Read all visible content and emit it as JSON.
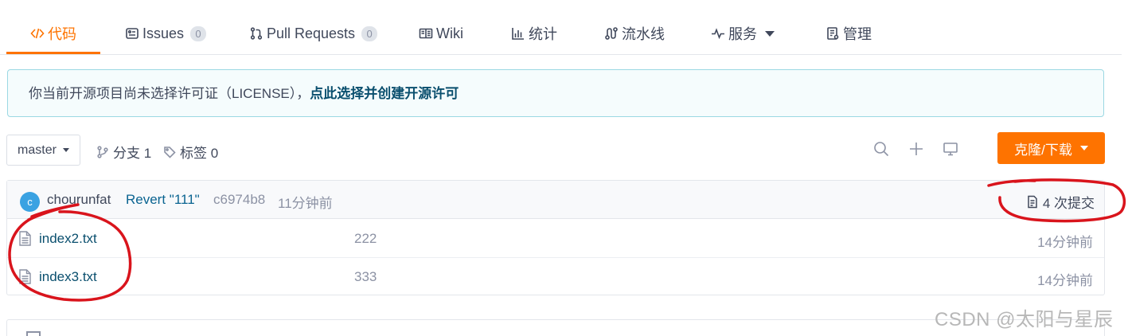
{
  "tabs": [
    {
      "label": "代码",
      "icon": "code-icon",
      "active": true
    },
    {
      "label": "Issues",
      "icon": "issues-icon",
      "count": "0"
    },
    {
      "label": "Pull Requests",
      "icon": "pull-request-icon",
      "count": "0"
    },
    {
      "label": "Wiki",
      "icon": "book-icon"
    },
    {
      "label": "统计",
      "icon": "bar-chart-icon"
    },
    {
      "label": "流水线",
      "icon": "pipeline-icon"
    },
    {
      "label": "服务",
      "icon": "pulse-icon"
    },
    {
      "label": "管理",
      "icon": "settings-doc-icon"
    }
  ],
  "notice": {
    "text": "你当前开源项目尚未选择许可证（LICENSE），",
    "link": "点此选择并创建开源许可"
  },
  "repo": {
    "branch": "master",
    "branches": "分支 1",
    "tags": "标签 0",
    "clone_label": "克隆/下载"
  },
  "commit": {
    "avatar_letter": "c",
    "author": "chourunfat",
    "message": "Revert \"111\"",
    "hash": "c6974b8",
    "time": "11分钟前",
    "commits_count": "4 次提交"
  },
  "files": [
    {
      "name": "index2.txt",
      "message": "222",
      "time": "14分钟前"
    },
    {
      "name": "index3.txt",
      "message": "333",
      "time": "14分钟前"
    }
  ],
  "watermark": "CSDN @太阳与星辰",
  "colors": {
    "accent": "#fe7300",
    "link": "#0a4f6e",
    "annotation": "#d9141c",
    "notice_bg": "#f5fcfd",
    "avatar": "#3aa2e2"
  }
}
